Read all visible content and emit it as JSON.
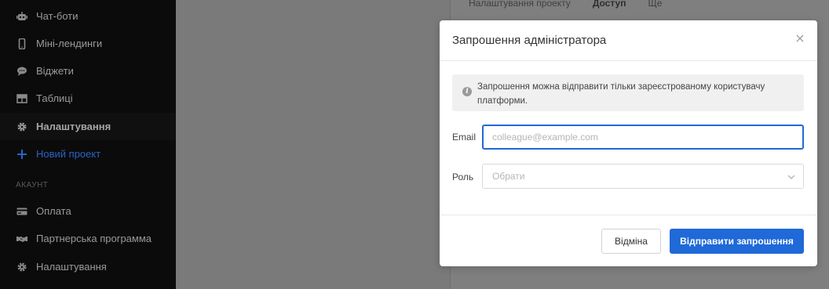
{
  "sidebar": {
    "items": [
      {
        "label": "Чат-боти",
        "icon": "robot-icon"
      },
      {
        "label": "Міні-лендинги",
        "icon": "phone-icon"
      },
      {
        "label": "Віджети",
        "icon": "chat-bubble-icon"
      },
      {
        "label": "Таблиці",
        "icon": "table-icon"
      },
      {
        "label": "Налаштування",
        "icon": "gear-icon"
      },
      {
        "label": "Новий проект",
        "icon": "plus-icon"
      }
    ],
    "section_label": "АКАУНТ",
    "account_items": [
      {
        "label": "Оплата",
        "icon": "credit-card-icon"
      },
      {
        "label": "Партнерська программа",
        "icon": "handshake-icon"
      },
      {
        "label": "Налаштування",
        "icon": "gear-icon"
      }
    ]
  },
  "background": {
    "tabs": [
      "Налаштування проекту",
      "Доступ",
      "Ще"
    ]
  },
  "modal": {
    "title": "Запрошення адміністратора",
    "info": "Запрошення можна відправити тільки зареєстрованому користувачу платформи.",
    "email_label": "Email",
    "email_placeholder": "colleague@example.com",
    "role_label": "Роль",
    "role_placeholder": "Обрати",
    "cancel_label": "Відміна",
    "send_label": "Відправити запрошення"
  },
  "colors": {
    "accent": "#1f69d8",
    "sidebar_bg": "#0b0b0b"
  }
}
